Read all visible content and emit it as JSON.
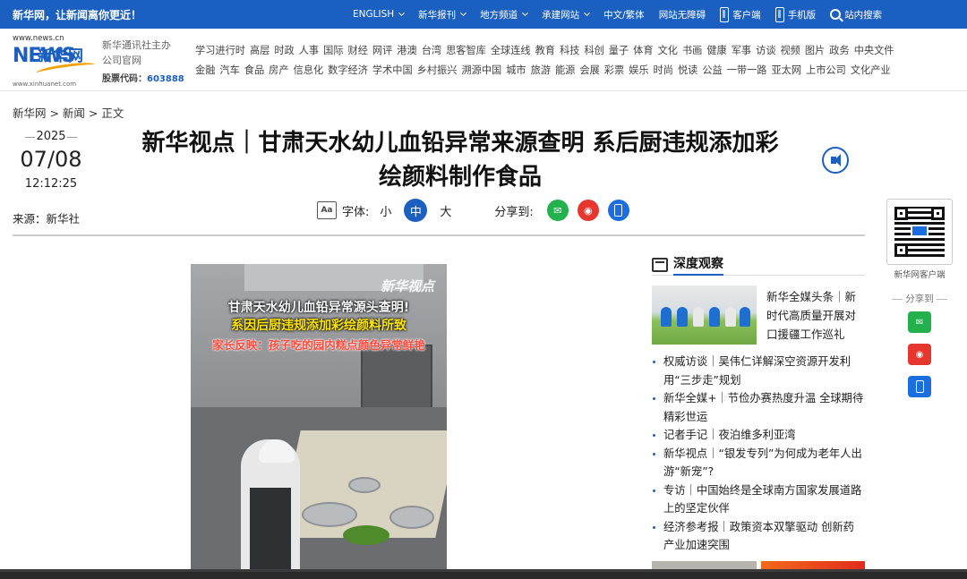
{
  "topbar": {
    "slogan": "新华网，让新闻离你更近！",
    "nav": [
      {
        "label": "ENGLISH",
        "caret": true
      },
      {
        "label": "新华报刊",
        "caret": true
      },
      {
        "label": "地方频道",
        "caret": true
      },
      {
        "label": "承建网站",
        "caret": true
      },
      {
        "label": "中文/繁体",
        "caret": false
      },
      {
        "label": "网站无障碍",
        "caret": false
      }
    ],
    "client_label": "客户端",
    "mobile_label": "手机版",
    "search_label": "站内搜索"
  },
  "header": {
    "logo_url_text": "www.news.cn",
    "logo_big": "NEWS",
    "logo_cn": "新华网",
    "logo_sub": "www.xinhuanet.com",
    "org_line1": "新华通讯社主办",
    "org_line2": "公司官网",
    "stock_label": "股票代码：",
    "stock_code": "603888",
    "channels_row1": [
      "学习进行时",
      "高层",
      "时政",
      "人事",
      "国际",
      "财经",
      "网评",
      "港澳",
      "台湾",
      "思客智库",
      "全球连线",
      "教育",
      "科技",
      "科创",
      "量子",
      "体育",
      "文化",
      "书画",
      "健康",
      "军事",
      "访谈",
      "视频",
      "图片",
      "政务",
      "中央文件"
    ],
    "channels_row2": [
      "金融",
      "汽车",
      "食品",
      "房产",
      "信息化",
      "数字经济",
      "学术中国",
      "乡村振兴",
      "溯源中国",
      "城市",
      "旅游",
      "能源",
      "会展",
      "彩票",
      "娱乐",
      "时尚",
      "悦读",
      "公益",
      "一带一路",
      "亚太网",
      "上市公司",
      "文化产业"
    ]
  },
  "breadcrumb": "新华网 > 新闻 > 正文",
  "article": {
    "year": "2025",
    "month_day": "07/08",
    "time": "12:12:25",
    "source": "来源：新华社",
    "title_line1": "新华视点｜甘肃天水幼儿血铅异常来源查明 系后厨违规添加彩",
    "title_line2": "绘颜料制作食品",
    "font_label": "字体:",
    "font_small": "小",
    "font_medium": "中",
    "font_large": "大",
    "share_label": "分享到:"
  },
  "video": {
    "brand": "新华视点",
    "caption1": "甘肃天水幼儿血铅异常源头查明!",
    "caption2": "系因后厨违规添加彩绘颜料所致",
    "caption3": "家长反映：孩子吃的园内糕点颜色异常鲜艳"
  },
  "sidebar": {
    "section_title": "深度观察",
    "featured_text": "新华全媒头条｜新时代高质量开展对口援疆工作巡礼",
    "items": [
      "权威访谈｜吴伟仁详解深空资源开发利用“三步走”规划",
      "新华全媒+｜节俭办赛热度升温 全球期待精彩世运",
      "记者手记｜夜泊维多利亚湾",
      "新华视点｜“银发专列”为何成为老年人出游“新宠”?",
      "专访｜中国始终是全球南方国家发展道路上的坚定伙伴",
      "经济参考报｜政策资本双擎驱动 创新药产业加速突围"
    ]
  },
  "rail": {
    "qr_label": "新华网客户端",
    "share_label": "分享到"
  },
  "colors": {
    "brand_blue": "#1b5fc1",
    "wechat_green": "#22b14c",
    "weibo_red": "#e6362d"
  },
  "icons": [
    "phone-icon",
    "tablet-icon",
    "search-icon",
    "font-size-icon",
    "audio-icon",
    "wechat-icon",
    "weibo-icon",
    "mobile-share-icon",
    "deep-observe-icon",
    "qr-code"
  ]
}
